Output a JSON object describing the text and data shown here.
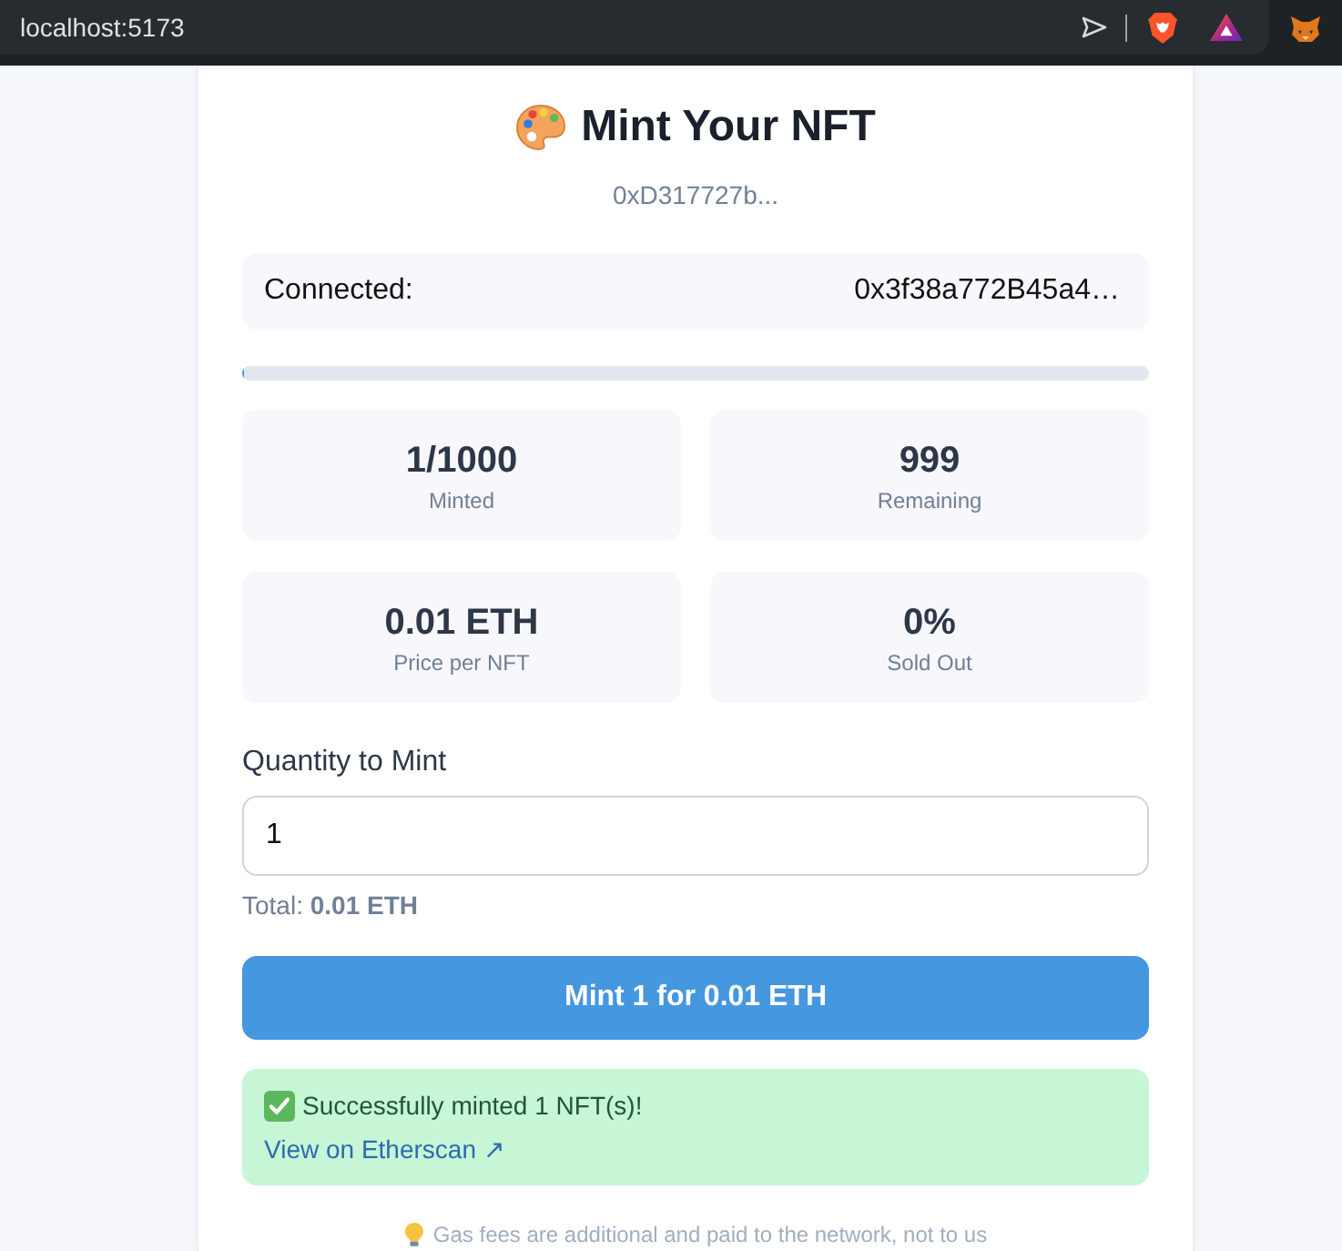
{
  "browser": {
    "url": "localhost:5173"
  },
  "header": {
    "title": "Mint Your NFT",
    "contract": "0xD317727b..."
  },
  "wallet": {
    "label": "Connected:",
    "address": "0x3f38a772B45a4…"
  },
  "progress": {
    "level": 0.001
  },
  "stats": [
    {
      "value": "1/1000",
      "label": "Minted"
    },
    {
      "value": "999",
      "label": "Remaining"
    },
    {
      "value": "0.01 ETH",
      "label": "Price per NFT"
    },
    {
      "value": "0%",
      "label": "Sold Out"
    }
  ],
  "quantity": {
    "label": "Quantity to Mint",
    "value": "1",
    "total": "Total: **0.01 ETH**"
  },
  "mint_button": {
    "label": "Mint 1 for 0.01 ETH"
  },
  "success": {
    "message": "Successfully minted 1 NFT(s)!",
    "link": "View on Etherscan ↗"
  },
  "footer_note": "Gas fees are additional and paid to the network, not to us"
}
